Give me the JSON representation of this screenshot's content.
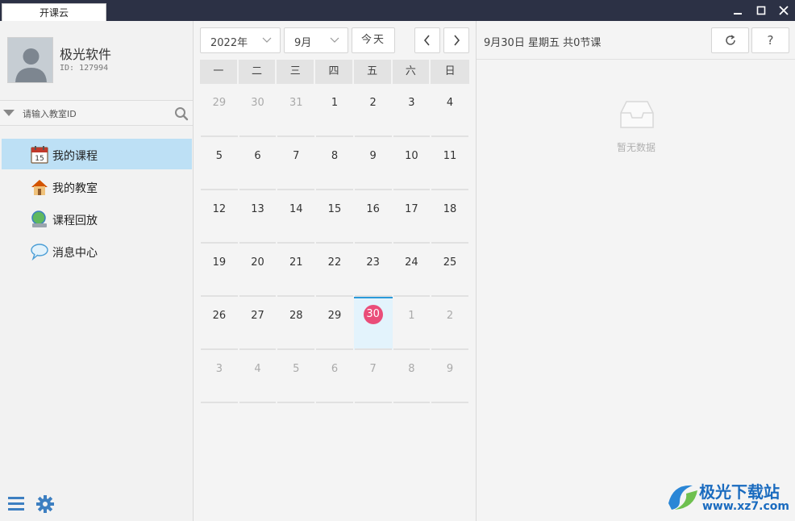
{
  "titlebar": {
    "app_tab": "开课云",
    "minimize": "–",
    "maximize": "□",
    "close": "✕"
  },
  "user": {
    "name": "极光软件",
    "id_text": "ID: 127994"
  },
  "search": {
    "placeholder": "请输入教室ID"
  },
  "nav": [
    {
      "label": "我的课程",
      "icon": "calendar-icon",
      "active": true
    },
    {
      "label": "我的教室",
      "icon": "house-icon",
      "active": false
    },
    {
      "label": "课程回放",
      "icon": "playback-icon",
      "active": false
    },
    {
      "label": "消息中心",
      "icon": "message-icon",
      "active": false
    }
  ],
  "calendar": {
    "year": "2022年",
    "month": "9月",
    "today": "今天",
    "weekdays": [
      "一",
      "二",
      "三",
      "四",
      "五",
      "六",
      "日"
    ],
    "weeks": [
      [
        {
          "d": "29",
          "o": true
        },
        {
          "d": "30",
          "o": true
        },
        {
          "d": "31",
          "o": true
        },
        {
          "d": "1"
        },
        {
          "d": "2"
        },
        {
          "d": "3"
        },
        {
          "d": "4"
        }
      ],
      [
        {
          "d": "5"
        },
        {
          "d": "6"
        },
        {
          "d": "7"
        },
        {
          "d": "8"
        },
        {
          "d": "9"
        },
        {
          "d": "10"
        },
        {
          "d": "11"
        }
      ],
      [
        {
          "d": "12"
        },
        {
          "d": "13"
        },
        {
          "d": "14"
        },
        {
          "d": "15"
        },
        {
          "d": "16"
        },
        {
          "d": "17"
        },
        {
          "d": "18"
        }
      ],
      [
        {
          "d": "19"
        },
        {
          "d": "20"
        },
        {
          "d": "21"
        },
        {
          "d": "22"
        },
        {
          "d": "23"
        },
        {
          "d": "24"
        },
        {
          "d": "25"
        }
      ],
      [
        {
          "d": "26"
        },
        {
          "d": "27"
        },
        {
          "d": "28"
        },
        {
          "d": "29"
        },
        {
          "d": "30",
          "sel": true
        },
        {
          "d": "1",
          "o": true
        },
        {
          "d": "2",
          "o": true
        }
      ],
      [
        {
          "d": "3",
          "o": true
        },
        {
          "d": "4",
          "o": true
        },
        {
          "d": "5",
          "o": true
        },
        {
          "d": "6",
          "o": true
        },
        {
          "d": "7",
          "o": true
        },
        {
          "d": "8",
          "o": true
        },
        {
          "d": "9",
          "o": true
        }
      ]
    ],
    "selected_color": "#ea4d79"
  },
  "right": {
    "date_summary": "9月30日 星期五 共0节课",
    "help": "?",
    "empty_text": "暂无数据"
  },
  "watermark": {
    "brand": "极光下载站",
    "url": "www.xz7.com"
  },
  "colors": {
    "titlebar": "#2c3145",
    "active_nav": "#bde0f5",
    "accent": "#2b9ad9"
  }
}
